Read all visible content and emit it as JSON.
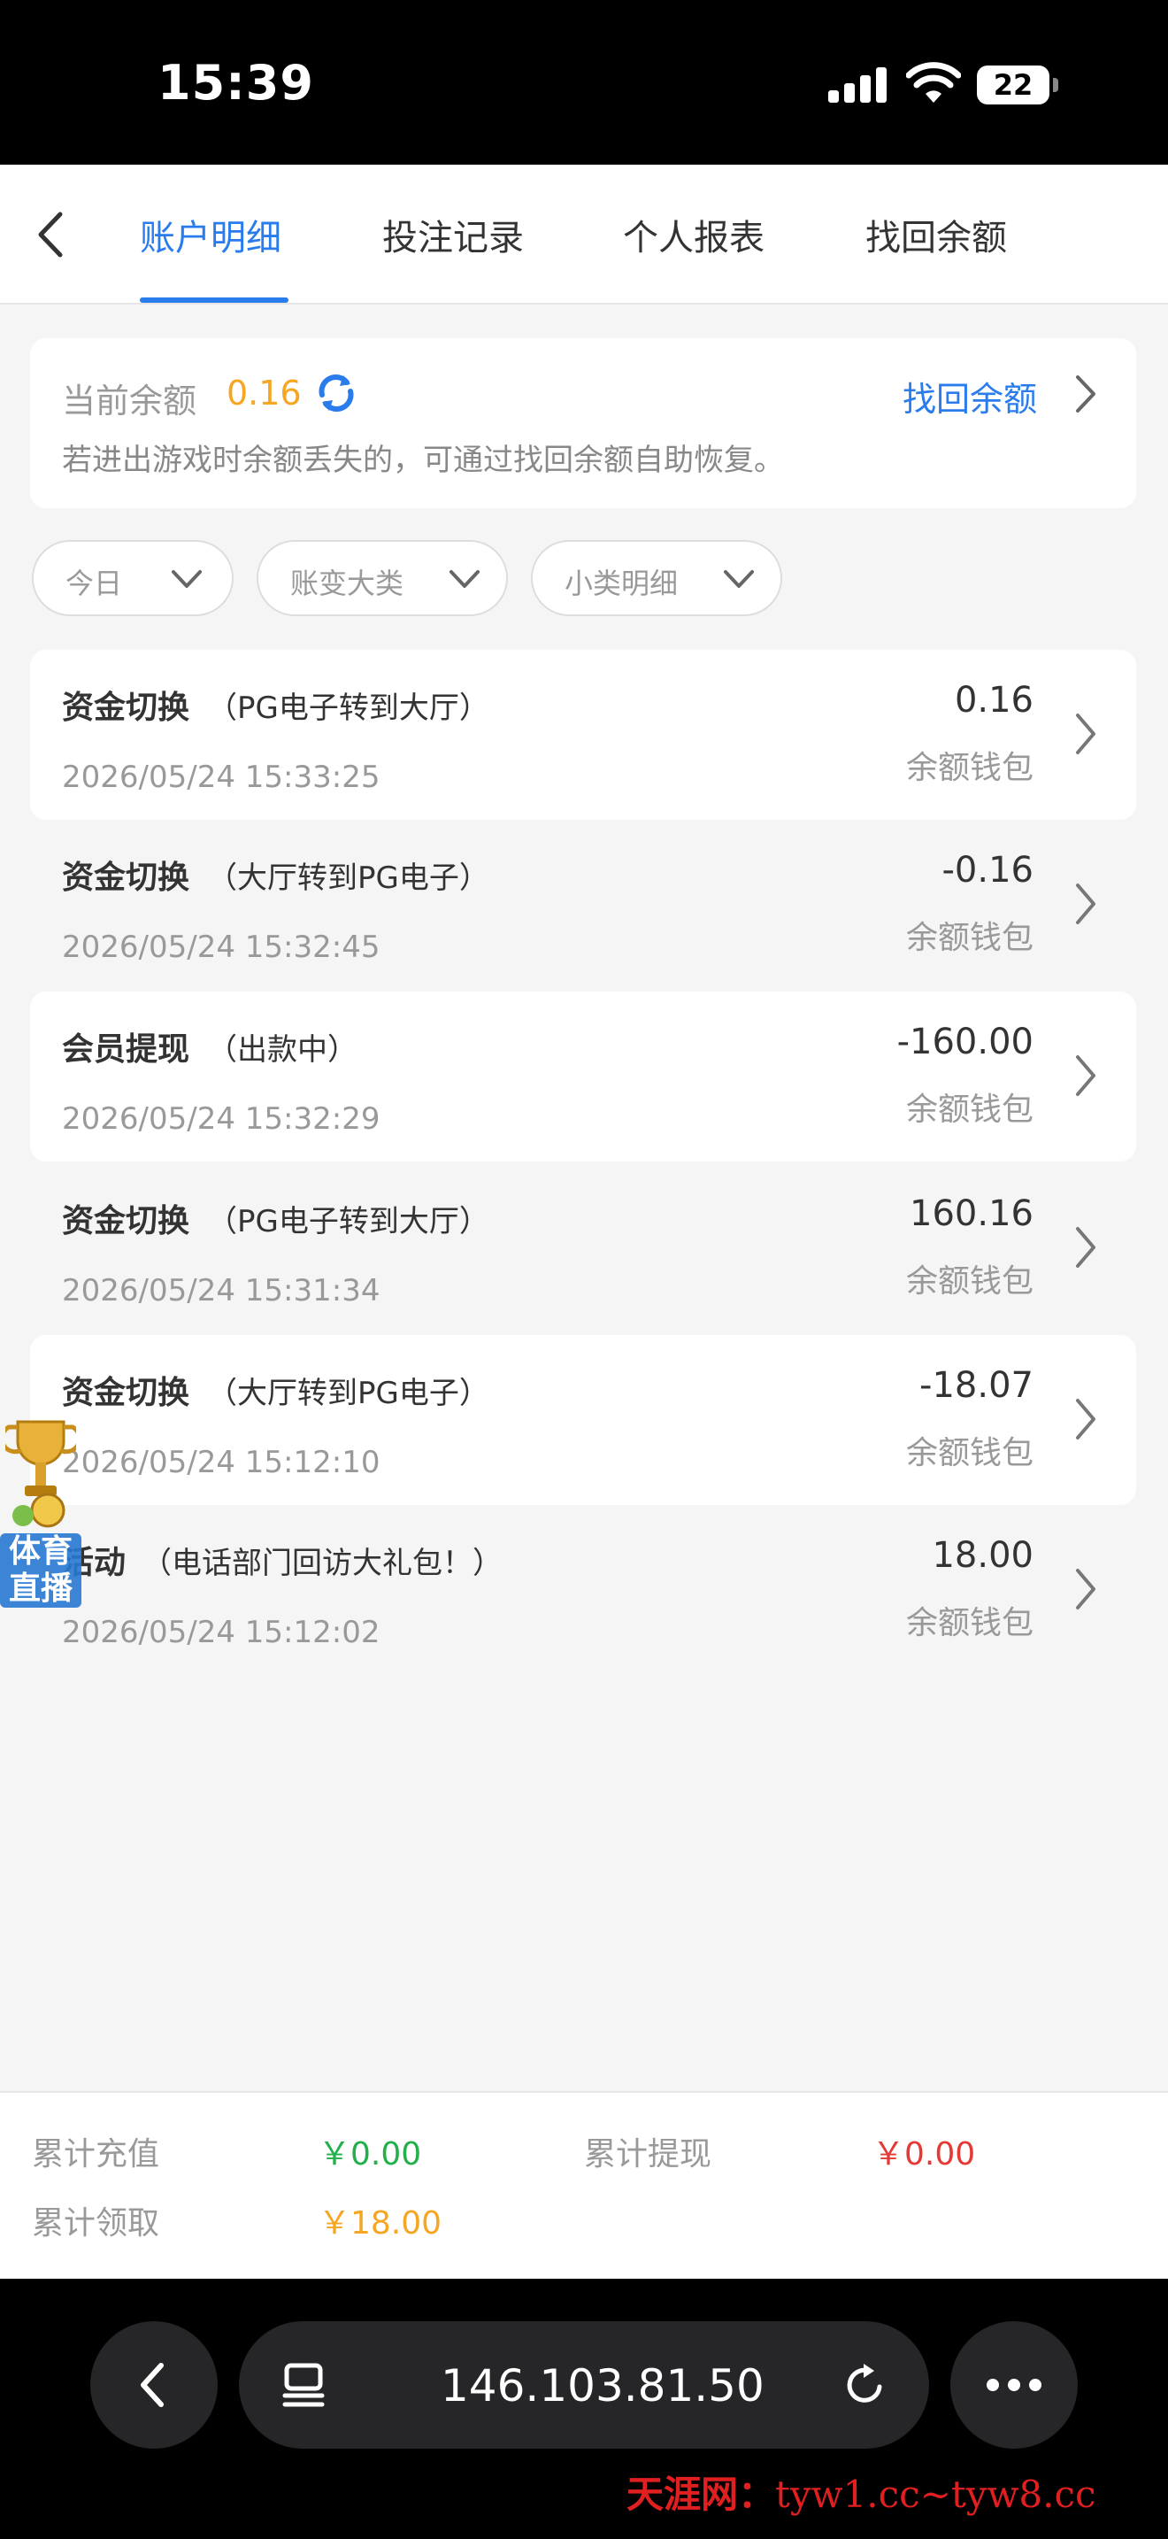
{
  "status_bar": {
    "time": "15:39",
    "battery": "22"
  },
  "tabs": [
    {
      "label": "账户明细",
      "active": true
    },
    {
      "label": "投注记录",
      "active": false
    },
    {
      "label": "个人报表",
      "active": false
    },
    {
      "label": "找回余额",
      "active": false
    }
  ],
  "balance": {
    "label": "当前余额",
    "value": "0.16",
    "recover_link": "找回余额",
    "hint": "若进出游戏时余额丢失的，可通过找回余额自助恢复。"
  },
  "filters": [
    {
      "label": "今日"
    },
    {
      "label": "账变大类"
    },
    {
      "label": "小类明细"
    }
  ],
  "records": [
    {
      "title": "资金切换",
      "sub": "（PG电子转到大厅）",
      "date": "2026/05/24 15:33:25",
      "amount": "0.16",
      "wallet": "余额钱包"
    },
    {
      "title": "资金切换",
      "sub": "（大厅转到PG电子）",
      "date": "2026/05/24 15:32:45",
      "amount": "-0.16",
      "wallet": "余额钱包"
    },
    {
      "title": "会员提现",
      "sub": "（出款中）",
      "date": "2026/05/24 15:32:29",
      "amount": "-160.00",
      "wallet": "余额钱包"
    },
    {
      "title": "资金切换",
      "sub": "（PG电子转到大厅）",
      "date": "2026/05/24 15:31:34",
      "amount": "160.16",
      "wallet": "余额钱包"
    },
    {
      "title": "资金切换",
      "sub": "（大厅转到PG电子）",
      "date": "2026/05/24 15:12:10",
      "amount": "-18.07",
      "wallet": "余额钱包"
    },
    {
      "title": "活动",
      "sub": "（电话部门回访大礼包！）",
      "date": "2026/05/24 15:12:02",
      "amount": "18.00",
      "wallet": "余额钱包"
    }
  ],
  "floating_badge": {
    "text_line1": "体育",
    "text_line2": "直播"
  },
  "summary": {
    "recharge_label": "累计充值",
    "recharge_value": "￥0.00",
    "withdraw_label": "累计提现",
    "withdraw_value": "￥0.00",
    "claim_label": "累计领取",
    "claim_value": "￥18.00"
  },
  "browser": {
    "url": "146.103.81.50"
  },
  "watermark": {
    "name": "天涯网：",
    "url": "tyw1.cc~tyw8.cc"
  },
  "colors": {
    "accent": "#2a7cec",
    "balance": "#f5a623",
    "recharge": "#22b04b",
    "withdraw": "#e53935",
    "claim": "#f5a623"
  },
  "icons": [
    "back-icon",
    "refresh-icon",
    "chevron-right-icon",
    "chevron-down-icon",
    "tabs-icon",
    "reload-icon",
    "more-icon",
    "trophy-icon"
  ]
}
